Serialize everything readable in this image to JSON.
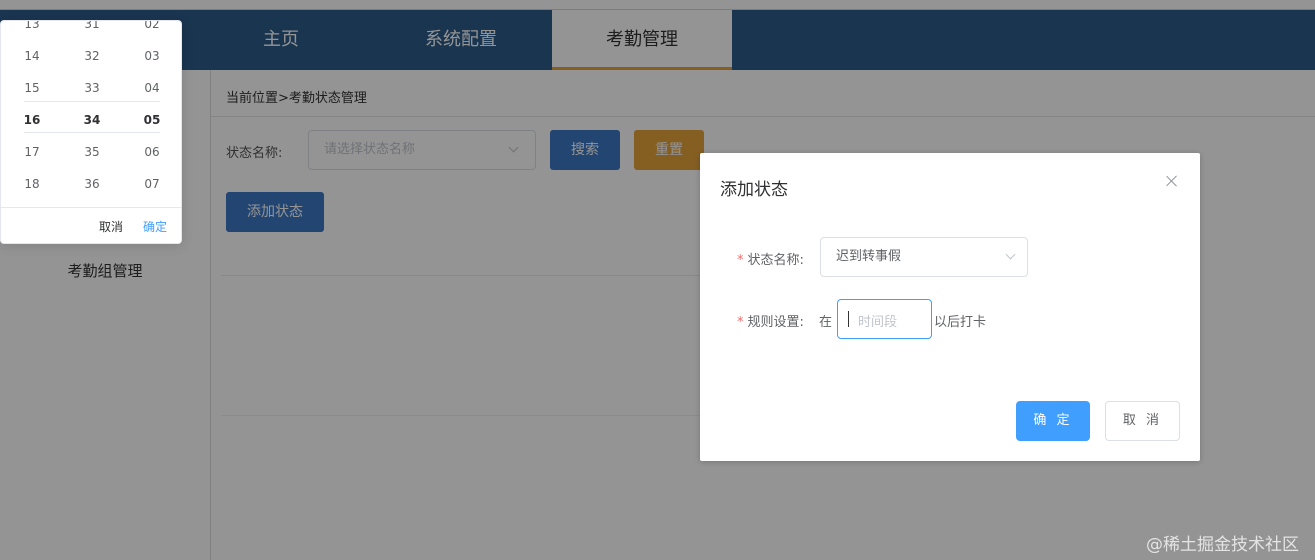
{
  "nav": {
    "tabs": [
      {
        "label": "主页",
        "active": false
      },
      {
        "label": "系统配置",
        "active": false
      },
      {
        "label": "考勤管理",
        "active": true
      }
    ]
  },
  "sidebar": {
    "items": [
      {
        "label": "考勤组管理"
      }
    ]
  },
  "main": {
    "breadcrumb": "当前位置>考勤状态管理",
    "filter": {
      "label": "状态名称:",
      "placeholder": "请选择状态名称",
      "search_button": "搜索",
      "reset_button": "重置"
    },
    "add_button": "添加状态"
  },
  "time_picker": {
    "hours": [
      "13",
      "14",
      "15",
      "16",
      "17",
      "18"
    ],
    "minutes": [
      "31",
      "32",
      "33",
      "34",
      "35",
      "36"
    ],
    "seconds": [
      "02",
      "03",
      "04",
      "05",
      "06",
      "07"
    ],
    "selected": {
      "hour": "16",
      "minute": "34",
      "second": "05"
    },
    "cancel_label": "取消",
    "confirm_label": "确定"
  },
  "dialog": {
    "title": "添加状态",
    "fields": {
      "status_name": {
        "label": "状态名称:",
        "value": "迟到转事假",
        "required": true
      },
      "rule": {
        "label": "规则设置:",
        "prefix": "在",
        "placeholder": "时间段",
        "suffix": "以后打卡",
        "required": true
      }
    },
    "ok_button": "确 定",
    "cancel_button": "取 消"
  },
  "watermark": "@稀土掘金技术社区",
  "colors": {
    "header": "#2e5c8a",
    "primary": "#409eff",
    "button_blue": "#3b78c4",
    "button_orange": "#e6a23c",
    "required": "#f56c6c"
  }
}
